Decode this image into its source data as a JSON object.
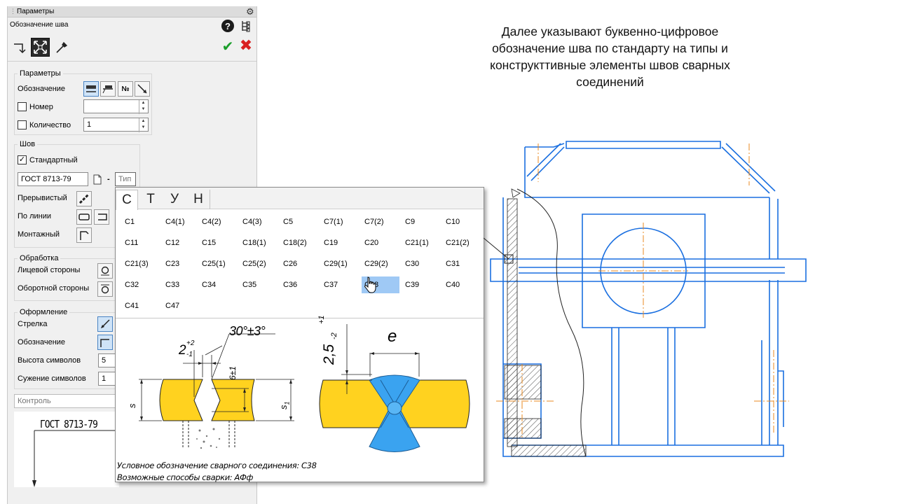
{
  "panel": {
    "title": "Параметры",
    "subtitle": "Обозначение шва",
    "icons": [
      "insert-icon",
      "fit-icon",
      "eyedropper-icon",
      "help-icon",
      "tree-icon",
      "confirm-icon",
      "cancel-icon",
      "gear-icon"
    ],
    "params_group": {
      "caption": "Параметры",
      "designation_label": "Обозначение",
      "number_label": "Номер",
      "number_value": "",
      "quantity_label": "Количество",
      "quantity_value": "1",
      "number_symbol": "№"
    },
    "seam_group": {
      "caption": "Шов",
      "standard_label": "Стандартный",
      "standard_checked": true,
      "standard_value": "ГОСТ 8713-79",
      "dash": "-",
      "type_placeholder": "Тип",
      "intermittent_label": "Прерывистый",
      "line_label": "По линии",
      "mounting_label": "Монтажный"
    },
    "processing_group": {
      "caption": "Обработка",
      "front_label": "Лицевой стороны",
      "back_label": "Оборотной стороны"
    },
    "appearance_group": {
      "caption": "Оформление",
      "arrow_label": "Стрелка",
      "designation_label": "Обозначение",
      "height_label": "Высота символов",
      "height_value": "5",
      "narrowing_label": "Сужение символов",
      "narrowing_value": "1"
    },
    "control_placeholder": "Контроль",
    "preview_text": "ГОСТ 8713-79"
  },
  "popup": {
    "tabs": [
      "С",
      "Т",
      "У",
      "Н"
    ],
    "active_tab": 0,
    "rows": [
      [
        "С1",
        "С4(1)",
        "С4(2)",
        "С4(3)",
        "С5",
        "С7(1)",
        "С7(2)",
        "С9",
        "С10"
      ],
      [
        "С11",
        "С12",
        "С15",
        "С18(1)",
        "С18(2)",
        "С19",
        "С20",
        "С21(1)",
        "С21(2)"
      ],
      [
        "С21(3)",
        "С23",
        "С25(1)",
        "С25(2)",
        "С26",
        "С29(1)",
        "С29(2)",
        "С30",
        "С31"
      ],
      [
        "С32",
        "С33",
        "С34",
        "С35",
        "С36",
        "С37",
        "С38",
        "С39",
        "С40"
      ],
      [
        "С41",
        "С47"
      ]
    ],
    "selected": "С38",
    "selected_display": "С38",
    "diagram": {
      "gap_label": "2",
      "gap_sup": "+2",
      "gap_sub": "-1",
      "angle_label": "30°±3°",
      "root_label": "6±1",
      "s_left": "s",
      "s_right": "s",
      "s_right_sub": "1",
      "bead_label": "2,5",
      "bead_sup": "+1",
      "bead_sub": "-2",
      "width_label": "e"
    },
    "caption_line1": "Условное обозначение сварного соединения: С38",
    "caption_line2": "Возможные способы сварки: АФф",
    "colors": {
      "metal": "#ffd21f",
      "weld": "#3aa3f0",
      "selection": "#9fc9f5"
    }
  },
  "heading": {
    "lines": [
      "Далее указывают буквенно-цифровое",
      "обозначение шва по стандарту на типы и",
      "конструкттивные элементы швов сварных",
      "соединений"
    ]
  },
  "drawing": {
    "line_color": "#1a6fe0",
    "axis_color": "#e88a20"
  }
}
